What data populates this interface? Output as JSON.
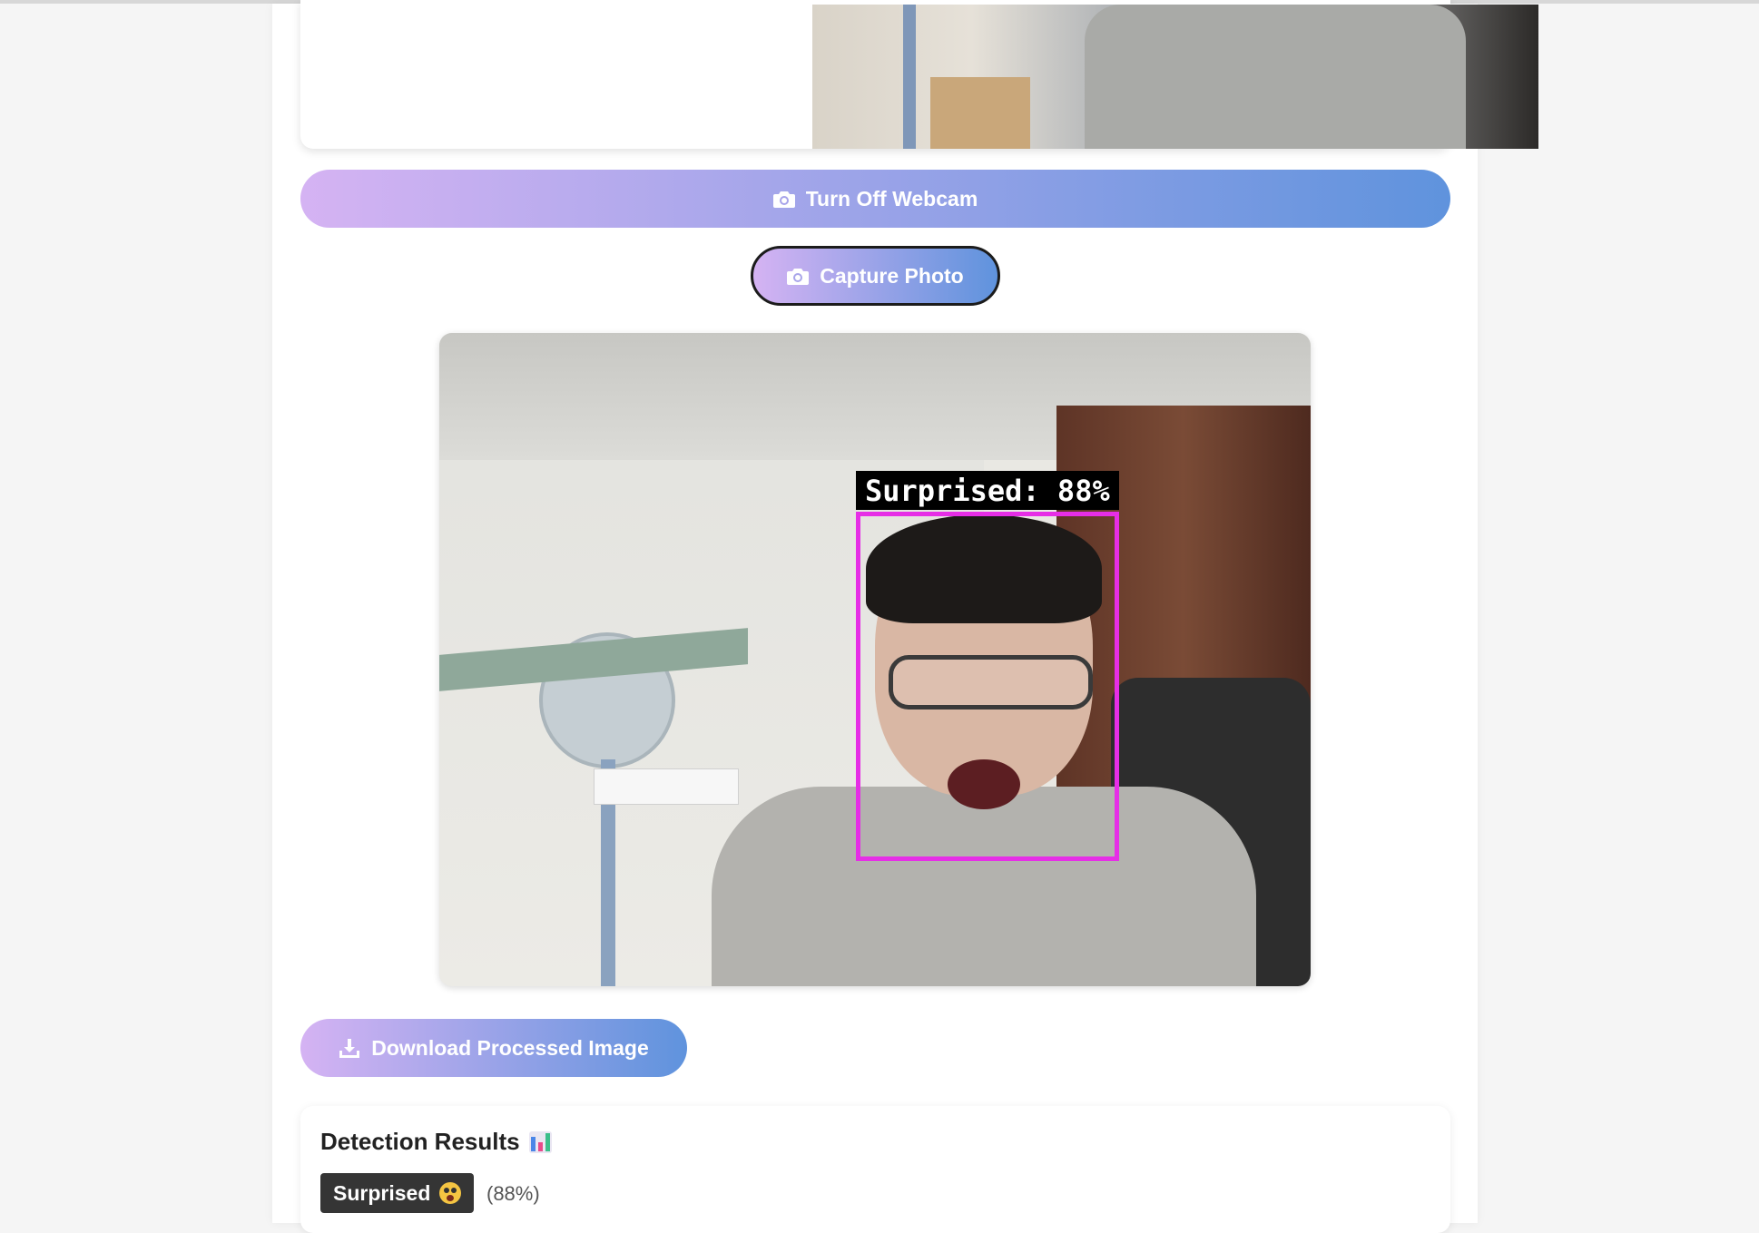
{
  "controls": {
    "webcam_toggle_label": "Turn Off Webcam",
    "capture_label": "Capture Photo",
    "download_label": "Download Processed Image"
  },
  "detection_overlay": {
    "label": "Surprised: 88%",
    "box_color": "#e62ee6"
  },
  "results": {
    "title": "Detection Results",
    "title_icon": "bar-chart-icon",
    "emotion": "Surprised",
    "emotion_icon": "astonished-face-emoji",
    "confidence": "(88%)"
  },
  "colors": {
    "button_gradient_start": "#d5b3f3",
    "button_gradient_end": "#5f93dd",
    "badge_bg": "#353535"
  }
}
